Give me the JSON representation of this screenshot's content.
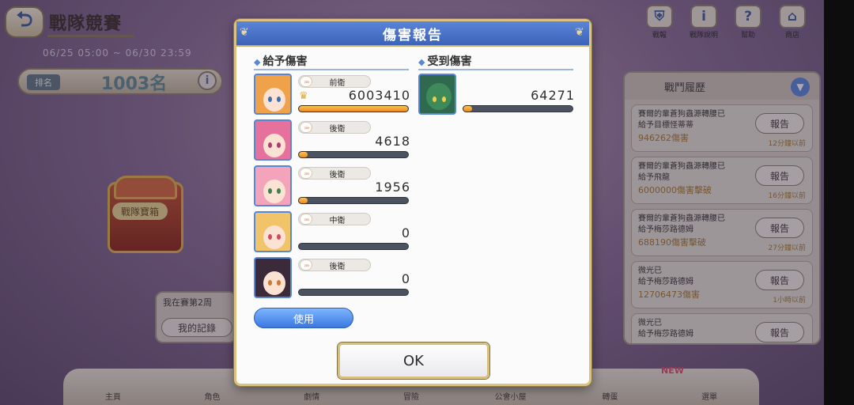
{
  "background": {
    "page_title": "戰隊競賽",
    "date_range": "06/25 05:00 ~ 06/30 23:59",
    "rank_label": "排名",
    "rank_value": "1003名",
    "chest_label": "戰隊寶箱",
    "panel_text": "我在賽第2周",
    "records_button": "我的記錄",
    "top_icons": [
      {
        "icon": "shield-icon",
        "symbol": "⛨",
        "label": "戰報"
      },
      {
        "icon": "info-icon",
        "symbol": "i",
        "label": "戰隊說明"
      },
      {
        "icon": "help-icon",
        "symbol": "?",
        "label": "幫助"
      },
      {
        "icon": "shop-icon",
        "symbol": "⌂",
        "label": "商店"
      }
    ],
    "history": {
      "title": "戰鬥履歷",
      "toggle_symbol": "▼",
      "entries": [
        {
          "line1": "賽爾的輩蒼狗蟲源轉腰已",
          "line2": "給予目標怪蒂蒂",
          "damage": "946262傷害",
          "time": "12分鐘以前",
          "button": "報告"
        },
        {
          "line1": "賽爾的輩蒼狗蟲源轉腰已",
          "line2": "給予飛龍",
          "damage": "6000000傷害擊破",
          "time": "16分鐘以前",
          "button": "報告"
        },
        {
          "line1": "賽爾的輩蒼狗蟲源轉腰已",
          "line2": "給予梅莎路德姆",
          "damage": "688190傷害擊破",
          "time": "27分鐘以前",
          "button": "報告"
        },
        {
          "line1": "微光已",
          "line2": "給予梅莎路德姆",
          "damage": "12706473傷害",
          "time": "1小時以前",
          "button": "報告"
        },
        {
          "line1": "微光已",
          "line2": "給予梅莎路德姆",
          "damage": "",
          "time": "",
          "button": "報告"
        }
      ]
    },
    "bottom_nav": [
      "主頁",
      "角色",
      "劇情",
      "冒險",
      "公會小屋",
      "轉蛋",
      "選單"
    ],
    "new_badge": "NEW"
  },
  "modal": {
    "title": "傷害報告",
    "dealt_section_label": "給予傷害",
    "received_section_label": "受到傷害",
    "section_marker": "◆",
    "position_chevron": "»»",
    "crown_symbol": "♛",
    "dealt": [
      {
        "position": "前衛",
        "damage": "6003410",
        "bar_fraction": 1.0,
        "top": true,
        "hair": "#f0a24a",
        "eye": "#3a6fb0"
      },
      {
        "position": "後衛",
        "damage": "4618",
        "bar_fraction": 0.08,
        "top": false,
        "hair": "#e6719c",
        "eye": "#b23a6e"
      },
      {
        "position": "後衛",
        "damage": "1956",
        "bar_fraction": 0.08,
        "top": false,
        "hair": "#f3a4bb",
        "eye": "#3f7f4f"
      },
      {
        "position": "中衛",
        "damage": "0",
        "bar_fraction": 0.0,
        "top": false,
        "hair": "#f2c46a",
        "eye": "#d04a60"
      },
      {
        "position": "後衛",
        "damage": "0",
        "bar_fraction": 0.0,
        "top": false,
        "hair": "#3b2a3a",
        "eye": "#c97a36"
      }
    ],
    "received": [
      {
        "damage": "64271",
        "bar_fraction": 0.08
      }
    ],
    "use_button": "使用",
    "ok_button": "OK",
    "colors": {
      "header": "#4a74cc",
      "bar_fill": "#f2a13a",
      "border_gold": "#dcc27e"
    }
  }
}
